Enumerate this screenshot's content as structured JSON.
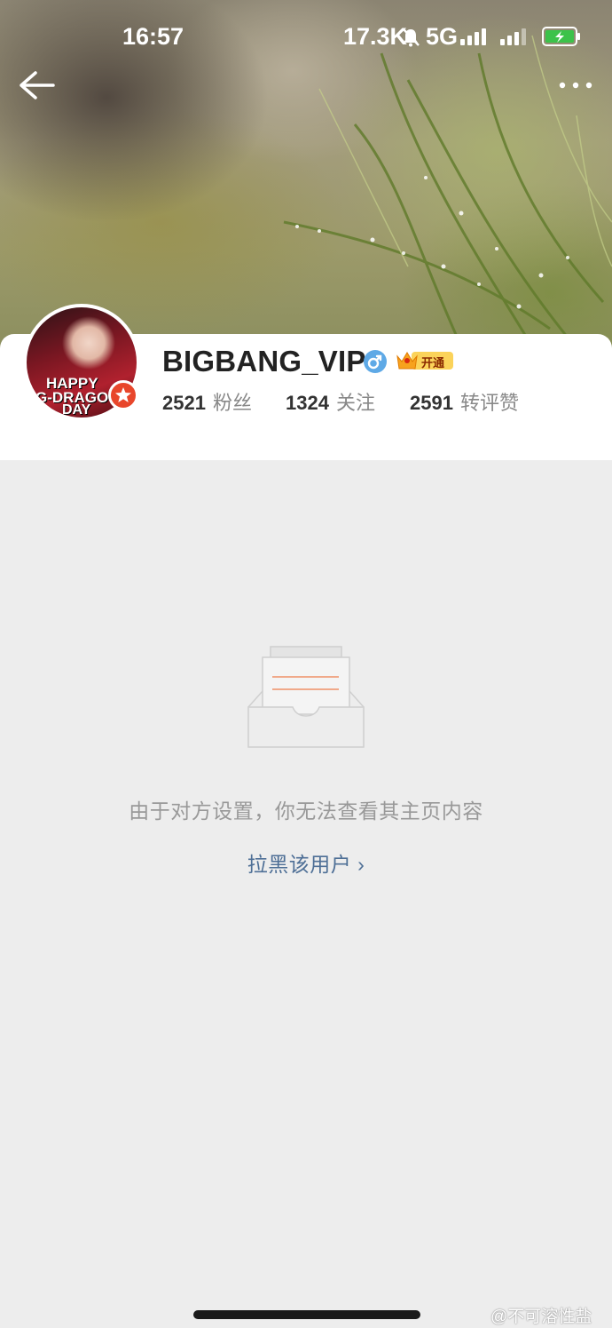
{
  "status_bar": {
    "time": "16:57",
    "network_speed": "17.3K",
    "network_type": "5G"
  },
  "profile": {
    "username": "BIGBANG_VIP",
    "vip_label": "开通",
    "avatar_lines": [
      "HAPPY",
      "G-DRAGO",
      "DAY"
    ],
    "stats": [
      {
        "value": "2521",
        "label": "粉丝"
      },
      {
        "value": "1324",
        "label": "关注"
      },
      {
        "value": "2591",
        "label": "转评赞"
      }
    ]
  },
  "empty_state": {
    "message": "由于对方设置，你无法查看其主页内容",
    "block_link": "拉黑该用户 ›"
  },
  "watermark": "@不可溶性盐",
  "colors": {
    "link": "#4e6f96",
    "gender": "#5ea9e6",
    "vip_gold": "#f7b21d"
  }
}
